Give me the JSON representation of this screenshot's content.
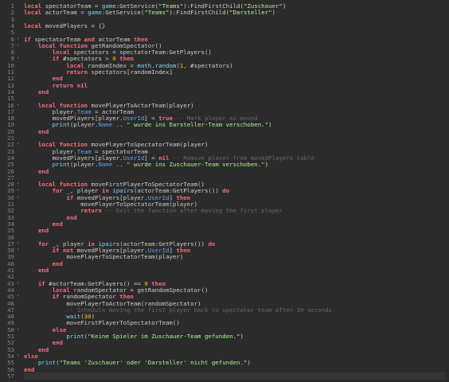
{
  "editor": {
    "colors": {
      "background": "#2b2b2b",
      "keyword": "#f86d7c",
      "string": "#adf195",
      "number": "#ffc600",
      "builtin": "#84d6f7",
      "property": "#61a1f1",
      "comment": "#666666",
      "text": "#cccccc",
      "line_number": "#858585"
    },
    "lines": [
      {
        "n": "1",
        "fold": false,
        "tokens": [
          [
            "kw",
            "local"
          ],
          [
            "plain",
            " spectatorTeam = "
          ],
          [
            "bi",
            "game"
          ],
          [
            "plain",
            ":GetService("
          ],
          [
            "str",
            "\"Teams\""
          ],
          [
            "plain",
            "):FindFirstChild("
          ],
          [
            "str",
            "\"Zuschauer\""
          ],
          [
            "plain",
            ")"
          ]
        ]
      },
      {
        "n": "2",
        "fold": false,
        "tokens": [
          [
            "kw",
            "local"
          ],
          [
            "plain",
            " actorTeam = "
          ],
          [
            "bi",
            "game"
          ],
          [
            "plain",
            ":GetService("
          ],
          [
            "str",
            "\"Teams\""
          ],
          [
            "plain",
            "):FindFirstChild("
          ],
          [
            "str",
            "\"Darsteller\""
          ],
          [
            "plain",
            ")"
          ]
        ]
      },
      {
        "n": "3",
        "fold": false,
        "tokens": []
      },
      {
        "n": "4",
        "fold": false,
        "tokens": [
          [
            "kw",
            "local"
          ],
          [
            "plain",
            " movedPlayers = {}"
          ]
        ]
      },
      {
        "n": "5",
        "fold": false,
        "tokens": []
      },
      {
        "n": "6",
        "fold": true,
        "tokens": [
          [
            "kw",
            "if"
          ],
          [
            "plain",
            " spectatorTeam "
          ],
          [
            "kw",
            "and"
          ],
          [
            "plain",
            " actorTeam "
          ],
          [
            "kw",
            "then"
          ]
        ]
      },
      {
        "n": "7",
        "fold": true,
        "tokens": [
          [
            "plain",
            "    "
          ],
          [
            "kw",
            "local function"
          ],
          [
            "plain",
            " getRandomSpectator()"
          ]
        ]
      },
      {
        "n": "8",
        "fold": false,
        "tokens": [
          [
            "plain",
            "        "
          ],
          [
            "kw",
            "local"
          ],
          [
            "plain",
            " spectators = spectatorTeam:GetPlayers()"
          ]
        ]
      },
      {
        "n": "9",
        "fold": true,
        "tokens": [
          [
            "plain",
            "        "
          ],
          [
            "kw",
            "if"
          ],
          [
            "plain",
            " #spectators > "
          ],
          [
            "num",
            "0"
          ],
          [
            "plain",
            " "
          ],
          [
            "kw",
            "then"
          ]
        ]
      },
      {
        "n": "10",
        "fold": false,
        "tokens": [
          [
            "plain",
            "            "
          ],
          [
            "kw",
            "local"
          ],
          [
            "plain",
            " randomIndex = "
          ],
          [
            "bi",
            "math"
          ],
          [
            "plain",
            "."
          ],
          [
            "bi",
            "random"
          ],
          [
            "plain",
            "("
          ],
          [
            "num",
            "1"
          ],
          [
            "plain",
            ", #spectators)"
          ]
        ]
      },
      {
        "n": "11",
        "fold": false,
        "tokens": [
          [
            "plain",
            "            "
          ],
          [
            "kw",
            "return"
          ],
          [
            "plain",
            " spectators[randomIndex]"
          ]
        ]
      },
      {
        "n": "12",
        "fold": false,
        "tokens": [
          [
            "plain",
            "        "
          ],
          [
            "kw",
            "end"
          ]
        ]
      },
      {
        "n": "13",
        "fold": false,
        "tokens": [
          [
            "plain",
            "        "
          ],
          [
            "kw",
            "return nil"
          ]
        ]
      },
      {
        "n": "14",
        "fold": false,
        "tokens": [
          [
            "plain",
            "    "
          ],
          [
            "kw",
            "end"
          ]
        ]
      },
      {
        "n": "15",
        "fold": false,
        "tokens": []
      },
      {
        "n": "16",
        "fold": true,
        "tokens": [
          [
            "plain",
            "    "
          ],
          [
            "kw",
            "local function"
          ],
          [
            "plain",
            " movePlayerToActorTeam(player)"
          ]
        ]
      },
      {
        "n": "17",
        "fold": false,
        "tokens": [
          [
            "plain",
            "        player."
          ],
          [
            "prop",
            "Team"
          ],
          [
            "plain",
            " = actorTeam"
          ]
        ]
      },
      {
        "n": "18",
        "fold": false,
        "tokens": [
          [
            "plain",
            "        movedPlayers[player."
          ],
          [
            "prop",
            "UserId"
          ],
          [
            "plain",
            "] = "
          ],
          [
            "kw",
            "true"
          ],
          [
            "plain",
            " "
          ],
          [
            "cmt",
            "-- Mark player as moved"
          ]
        ]
      },
      {
        "n": "19",
        "fold": false,
        "tokens": [
          [
            "plain",
            "        "
          ],
          [
            "bi",
            "print"
          ],
          [
            "plain",
            "(player."
          ],
          [
            "prop",
            "Name"
          ],
          [
            "plain",
            " .. "
          ],
          [
            "str",
            "\" wurde ins Darsteller-Team verschoben.\""
          ],
          [
            "plain",
            ")"
          ]
        ]
      },
      {
        "n": "20",
        "fold": false,
        "tokens": [
          [
            "plain",
            "    "
          ],
          [
            "kw",
            "end"
          ]
        ]
      },
      {
        "n": "21",
        "fold": false,
        "tokens": []
      },
      {
        "n": "22",
        "fold": true,
        "tokens": [
          [
            "plain",
            "    "
          ],
          [
            "kw",
            "local function"
          ],
          [
            "plain",
            " movePlayerToSpectatorTeam(player)"
          ]
        ]
      },
      {
        "n": "23",
        "fold": false,
        "tokens": [
          [
            "plain",
            "        player."
          ],
          [
            "prop",
            "Team"
          ],
          [
            "plain",
            " = spectatorTeam"
          ]
        ]
      },
      {
        "n": "24",
        "fold": false,
        "tokens": [
          [
            "plain",
            "        movedPlayers[player."
          ],
          [
            "prop",
            "UserId"
          ],
          [
            "plain",
            "] = "
          ],
          [
            "kw",
            "nil"
          ],
          [
            "plain",
            " "
          ],
          [
            "cmt",
            "-- Remove player from movedPlayers table"
          ]
        ]
      },
      {
        "n": "25",
        "fold": false,
        "tokens": [
          [
            "plain",
            "        "
          ],
          [
            "bi",
            "print"
          ],
          [
            "plain",
            "(player."
          ],
          [
            "prop",
            "Name"
          ],
          [
            "plain",
            " .. "
          ],
          [
            "str",
            "\" wurde ins Zuschauer-Team verschoben.\""
          ],
          [
            "plain",
            ")"
          ]
        ]
      },
      {
        "n": "26",
        "fold": false,
        "tokens": [
          [
            "plain",
            "    "
          ],
          [
            "kw",
            "end"
          ]
        ]
      },
      {
        "n": "27",
        "fold": false,
        "tokens": []
      },
      {
        "n": "28",
        "fold": true,
        "tokens": [
          [
            "plain",
            "    "
          ],
          [
            "kw",
            "local function"
          ],
          [
            "plain",
            " moveFirstPlayerToSpectatorTeam()"
          ]
        ]
      },
      {
        "n": "29",
        "fold": true,
        "tokens": [
          [
            "plain",
            "        "
          ],
          [
            "kw",
            "for"
          ],
          [
            "plain",
            " _, player "
          ],
          [
            "kw",
            "in"
          ],
          [
            "plain",
            " "
          ],
          [
            "bi",
            "ipairs"
          ],
          [
            "plain",
            "(actorTeam:GetPlayers()) "
          ],
          [
            "kw",
            "do"
          ]
        ]
      },
      {
        "n": "30",
        "fold": true,
        "tokens": [
          [
            "plain",
            "            "
          ],
          [
            "kw",
            "if"
          ],
          [
            "plain",
            " movedPlayers[player."
          ],
          [
            "prop",
            "UserId"
          ],
          [
            "plain",
            "] "
          ],
          [
            "kw",
            "then"
          ]
        ]
      },
      {
        "n": "31",
        "fold": false,
        "tokens": [
          [
            "plain",
            "                movePlayerToSpectatorTeam(player)"
          ]
        ]
      },
      {
        "n": "32",
        "fold": false,
        "tokens": [
          [
            "plain",
            "                "
          ],
          [
            "kw",
            "return"
          ],
          [
            "plain",
            " "
          ],
          [
            "cmt",
            "-- Exit the function after moving the first player"
          ]
        ]
      },
      {
        "n": "33",
        "fold": false,
        "tokens": [
          [
            "plain",
            "            "
          ],
          [
            "kw",
            "end"
          ]
        ]
      },
      {
        "n": "34",
        "fold": false,
        "tokens": [
          [
            "plain",
            "        "
          ],
          [
            "kw",
            "end"
          ]
        ]
      },
      {
        "n": "35",
        "fold": false,
        "tokens": [
          [
            "plain",
            "    "
          ],
          [
            "kw",
            "end"
          ]
        ]
      },
      {
        "n": "36",
        "fold": false,
        "tokens": []
      },
      {
        "n": "37",
        "fold": true,
        "tokens": [
          [
            "plain",
            "    "
          ],
          [
            "kw",
            "for"
          ],
          [
            "plain",
            " _, player "
          ],
          [
            "kw",
            "in"
          ],
          [
            "plain",
            " "
          ],
          [
            "bi",
            "ipairs"
          ],
          [
            "plain",
            "(actorTeam:GetPlayers()) "
          ],
          [
            "kw",
            "do"
          ]
        ]
      },
      {
        "n": "38",
        "fold": true,
        "tokens": [
          [
            "plain",
            "        "
          ],
          [
            "kw",
            "if not"
          ],
          [
            "plain",
            " movedPlayers[player."
          ],
          [
            "prop",
            "UserId"
          ],
          [
            "plain",
            "] "
          ],
          [
            "kw",
            "then"
          ]
        ]
      },
      {
        "n": "39",
        "fold": false,
        "tokens": [
          [
            "plain",
            "            movePlayerToSpectatorTeam(player)"
          ]
        ]
      },
      {
        "n": "40",
        "fold": false,
        "tokens": [
          [
            "plain",
            "        "
          ],
          [
            "kw",
            "end"
          ]
        ]
      },
      {
        "n": "41",
        "fold": false,
        "tokens": [
          [
            "plain",
            "    "
          ],
          [
            "kw",
            "end"
          ]
        ]
      },
      {
        "n": "42",
        "fold": false,
        "tokens": []
      },
      {
        "n": "43",
        "fold": true,
        "tokens": [
          [
            "plain",
            "    "
          ],
          [
            "kw",
            "if"
          ],
          [
            "plain",
            " #actorTeam:GetPlayers() == "
          ],
          [
            "num",
            "0"
          ],
          [
            "plain",
            " "
          ],
          [
            "kw",
            "then"
          ]
        ]
      },
      {
        "n": "44",
        "fold": false,
        "tokens": [
          [
            "plain",
            "        "
          ],
          [
            "kw",
            "local"
          ],
          [
            "plain",
            " randomSpectator = getRandomSpectator()"
          ]
        ]
      },
      {
        "n": "45",
        "fold": true,
        "tokens": [
          [
            "plain",
            "        "
          ],
          [
            "kw",
            "if"
          ],
          [
            "plain",
            " randomSpectator "
          ],
          [
            "kw",
            "then"
          ]
        ]
      },
      {
        "n": "46",
        "fold": false,
        "tokens": [
          [
            "plain",
            "            movePlayerToActorTeam(randomSpectator)"
          ]
        ]
      },
      {
        "n": "47",
        "fold": false,
        "tokens": [
          [
            "plain",
            "            "
          ],
          [
            "cmt",
            "-- Schedule moving the first player back to spectator team after 30 seconds"
          ]
        ]
      },
      {
        "n": "48",
        "fold": false,
        "tokens": [
          [
            "plain",
            "            "
          ],
          [
            "bi",
            "wait"
          ],
          [
            "plain",
            "("
          ],
          [
            "num",
            "30"
          ],
          [
            "plain",
            ")"
          ]
        ]
      },
      {
        "n": "49",
        "fold": false,
        "tokens": [
          [
            "plain",
            "            moveFirstPlayerToSpectatorTeam()"
          ]
        ]
      },
      {
        "n": "50",
        "fold": true,
        "tokens": [
          [
            "plain",
            "        "
          ],
          [
            "kw",
            "else"
          ]
        ]
      },
      {
        "n": "51",
        "fold": false,
        "tokens": [
          [
            "plain",
            "            "
          ],
          [
            "bi",
            "print"
          ],
          [
            "plain",
            "("
          ],
          [
            "str",
            "\"Keine Spieler im Zuschauer-Team gefunden.\""
          ],
          [
            "plain",
            ")"
          ]
        ]
      },
      {
        "n": "52",
        "fold": false,
        "tokens": [
          [
            "plain",
            "        "
          ],
          [
            "kw",
            "end"
          ]
        ]
      },
      {
        "n": "53",
        "fold": false,
        "tokens": [
          [
            "plain",
            "    "
          ],
          [
            "kw",
            "end"
          ]
        ]
      },
      {
        "n": "54",
        "fold": true,
        "tokens": [
          [
            "kw",
            "else"
          ]
        ]
      },
      {
        "n": "55",
        "fold": false,
        "tokens": [
          [
            "plain",
            "    "
          ],
          [
            "bi",
            "print"
          ],
          [
            "plain",
            "("
          ],
          [
            "str",
            "\"Teams 'Zuschauer' oder 'Darsteller' nicht gefunden.\""
          ],
          [
            "plain",
            ")"
          ]
        ]
      },
      {
        "n": "56",
        "fold": false,
        "tokens": [
          [
            "kw",
            "end"
          ]
        ]
      },
      {
        "n": "57",
        "fold": false,
        "tokens": []
      }
    ],
    "cursor_line": "57"
  }
}
